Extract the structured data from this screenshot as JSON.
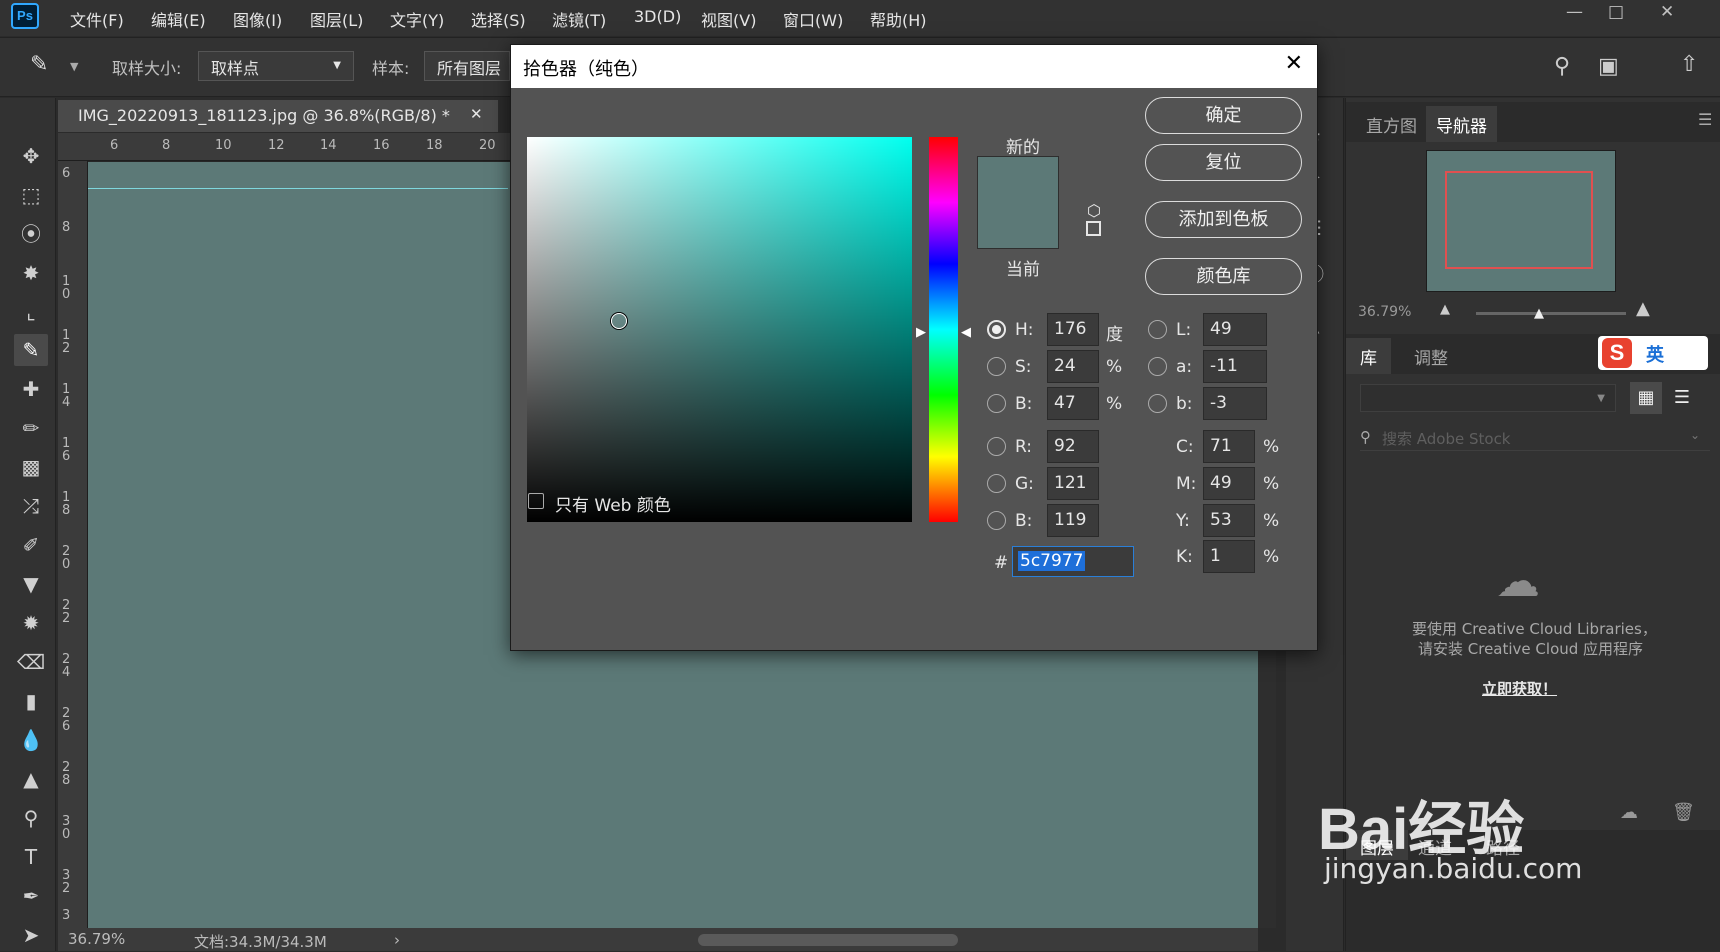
{
  "app": {
    "logo": "Ps"
  },
  "menu": [
    "文件(F)",
    "编辑(E)",
    "图像(I)",
    "图层(L)",
    "文字(Y)",
    "选择(S)",
    "滤镜(T)",
    "3D(D)",
    "视图(V)",
    "窗口(W)",
    "帮助(H)"
  ],
  "options": {
    "sample_size_label": "取样大小:",
    "sample_size_value": "取样点",
    "sample_label": "样本:",
    "sample_value": "所有图层"
  },
  "document": {
    "tab_title": "IMG_20220913_181123.jpg @ 36.8%(RGB/8) *",
    "zoom": "36.79%",
    "doc_info": "文档:34.3M/34.3M",
    "canvas_color": "#5c7977"
  },
  "ruler": {
    "h_ticks": [
      "6",
      "8",
      "10",
      "12",
      "14",
      "16",
      "18",
      "20"
    ],
    "v_ticks": [
      "6",
      "8",
      "1 0",
      "1 2",
      "1 4",
      "1 6",
      "1 8",
      "2 0",
      "2 2",
      "2 4",
      "2 6",
      "2 8",
      "3 0",
      "3 2",
      "3"
    ]
  },
  "dialog": {
    "title": "拾色器（纯色）",
    "new_label": "新的",
    "current_label": "当前",
    "web_only_label": "只有 Web 颜色",
    "buttons": {
      "ok": "确定",
      "reset": "复位",
      "add_swatch": "添加到色板",
      "color_libraries": "颜色库"
    },
    "hsb": [
      {
        "label": "H:",
        "value": "176",
        "unit": "度"
      },
      {
        "label": "S:",
        "value": "24",
        "unit": "%"
      },
      {
        "label": "B:",
        "value": "47",
        "unit": "%"
      }
    ],
    "lab": [
      {
        "label": "L:",
        "value": "49"
      },
      {
        "label": "a:",
        "value": "-11"
      },
      {
        "label": "b:",
        "value": "-3"
      }
    ],
    "rgb": [
      {
        "label": "R:",
        "value": "92"
      },
      {
        "label": "G:",
        "value": "121"
      },
      {
        "label": "B:",
        "value": "119"
      }
    ],
    "cmyk": [
      {
        "label": "C:",
        "value": "71",
        "unit": "%"
      },
      {
        "label": "M:",
        "value": "49",
        "unit": "%"
      },
      {
        "label": "Y:",
        "value": "53",
        "unit": "%"
      },
      {
        "label": "K:",
        "value": "1",
        "unit": "%"
      }
    ],
    "hex_label": "#",
    "hex_value": "5c7977",
    "swatch_color": "#5c7977"
  },
  "right_panel": {
    "top_tabs": [
      "直方图",
      "导航器"
    ],
    "nav_zoom": "36.79%",
    "lib_tabs": [
      "库",
      "调整"
    ],
    "search_placeholder": "搜索 Adobe Stock",
    "cc_message_1": "要使用 Creative Cloud Libraries，",
    "cc_message_2": "请安装 Creative Cloud 应用程序",
    "cc_link": "立即获取！",
    "bottom_tabs": [
      "图层",
      "通道",
      "路径"
    ],
    "ime_label": "英"
  },
  "watermark": {
    "logo_text": "Bai经验",
    "url": "jingyan.baidu.com"
  }
}
